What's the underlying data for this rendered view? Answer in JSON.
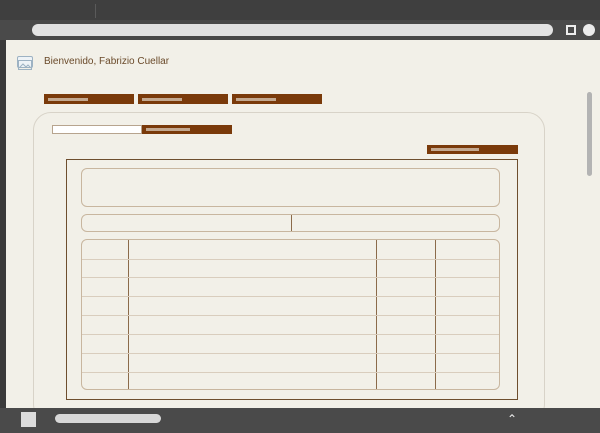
{
  "header": {
    "welcome_text": "Bienvenido, Fabrizio Cuellar",
    "logo_icon": "image-placeholder-icon"
  },
  "nav": {
    "buttons": [
      "",
      "",
      ""
    ],
    "accent_color": "#7a3a0a"
  },
  "search": {
    "value": "",
    "button_label": ""
  },
  "action": {
    "button_label": ""
  },
  "form": {
    "notes_value": "",
    "field_left": "",
    "field_right": ""
  },
  "table": {
    "columns": [
      "",
      "",
      "",
      ""
    ],
    "rows": [
      [
        "",
        "",
        "",
        ""
      ],
      [
        "",
        "",
        "",
        ""
      ],
      [
        "",
        "",
        "",
        ""
      ],
      [
        "",
        "",
        "",
        ""
      ],
      [
        "",
        "",
        "",
        ""
      ],
      [
        "",
        "",
        "",
        ""
      ],
      [
        "",
        "",
        "",
        ""
      ],
      [
        "",
        "",
        "",
        ""
      ]
    ]
  },
  "taskbar": {
    "tray_icon": "chevron-up-icon"
  }
}
